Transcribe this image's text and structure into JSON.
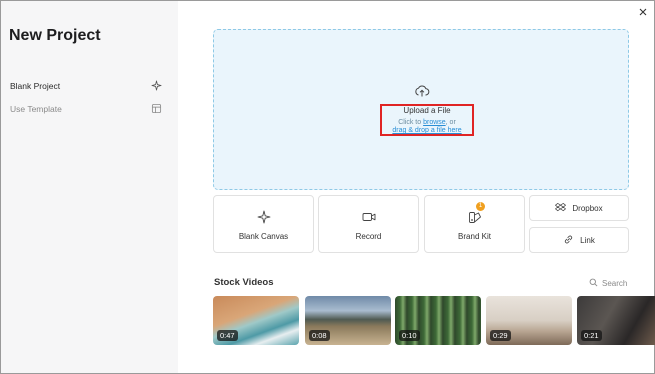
{
  "sidebar": {
    "title": "New Project",
    "items": [
      {
        "label": "Blank Project",
        "icon": "sparkle-icon",
        "active": true
      },
      {
        "label": "Use Template",
        "icon": "template-icon",
        "active": false
      }
    ]
  },
  "upload": {
    "title": "Upload a File",
    "hint_prefix": "Click to ",
    "hint_link": "browse",
    "hint_suffix": ", or",
    "hint_line2": "drag & drop a file here"
  },
  "tiles": {
    "blank_canvas": "Blank Canvas",
    "record": "Record",
    "brand_kit": "Brand Kit",
    "brand_kit_badge": "1",
    "dropbox": "Dropbox",
    "link": "Link"
  },
  "stock": {
    "title": "Stock Videos",
    "search_label": "Search",
    "videos": [
      {
        "duration": "0:47",
        "theme": "aerial-beach"
      },
      {
        "duration": "0:08",
        "theme": "mountain-road"
      },
      {
        "duration": "0:10",
        "theme": "forest"
      },
      {
        "duration": "0:29",
        "theme": "yoga"
      },
      {
        "duration": "0:21",
        "theme": "studio"
      }
    ]
  },
  "colors": {
    "accent_link": "#2a8fd6",
    "highlight_box": "#e02424",
    "upload_bg": "#eaf5fc",
    "badge": "#f0a020"
  }
}
